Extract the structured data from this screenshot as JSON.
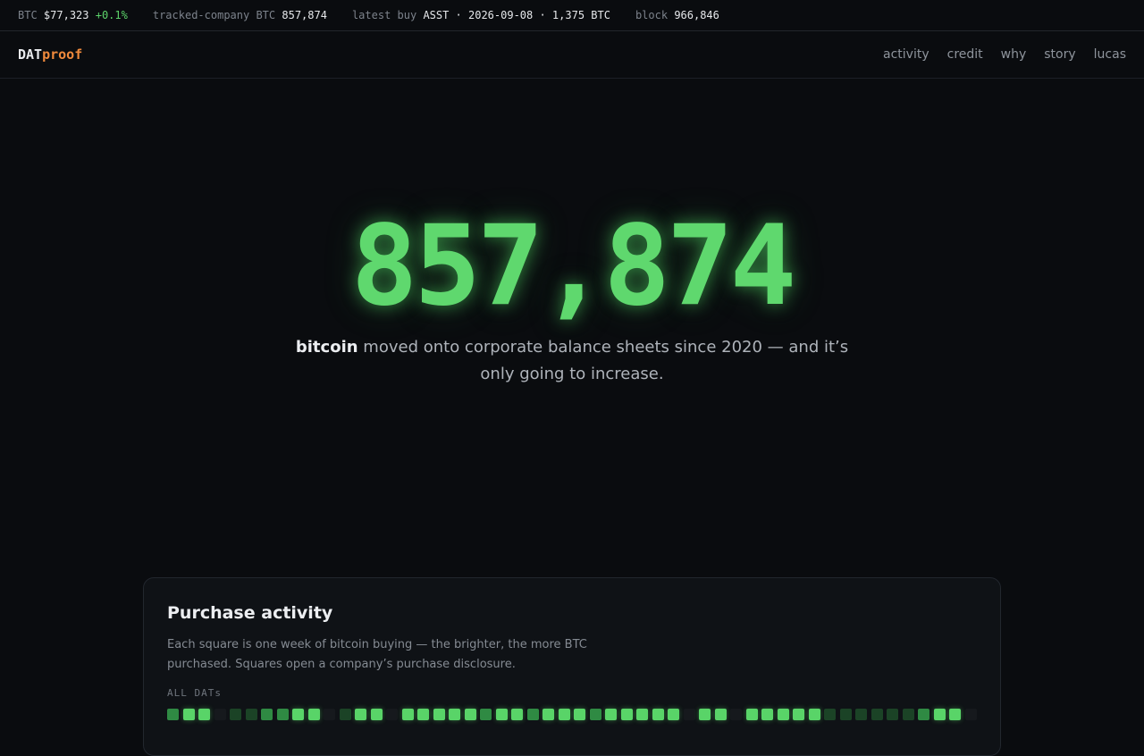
{
  "ticker": {
    "btc_label": "BTC",
    "btc_price": "$77,323",
    "btc_change": "+0.1%",
    "tracked_label": "tracked-company BTC",
    "tracked_value": "857,874",
    "latest_label": "latest buy",
    "latest_value": "ASST · 2026-09-08 · 1,375 BTC",
    "block_label": "block",
    "block_value": "966,846"
  },
  "brand": {
    "part1": "DAT",
    "part2": "proof",
    "accent_color": "#f08a3c"
  },
  "nav": {
    "items": [
      "activity",
      "credit",
      "why",
      "story",
      "lucas"
    ]
  },
  "hero": {
    "number": "857,874",
    "sub_bold": "bitcoin",
    "sub_rest": "moved onto corporate balance sheets since 2020 — and it’s only going to increase.",
    "accent_color": "#5fd86e"
  },
  "activity": {
    "title": "Purchase activity",
    "description": "Each square is one week of bitcoin buying — the brighter, the more BTC purchased. Squares open a company’s purchase disclosure.",
    "label": "ALL DATs",
    "weeks": [
      2,
      3,
      3,
      0,
      1,
      1,
      2,
      2,
      3,
      3,
      0,
      1,
      3,
      3,
      0,
      3,
      3,
      3,
      3,
      3,
      2,
      3,
      3,
      2,
      3,
      3,
      3,
      2,
      3,
      3,
      3,
      3,
      3,
      0,
      3,
      3,
      0,
      3,
      3,
      3,
      3,
      3,
      1,
      1,
      1,
      1,
      1,
      1,
      2,
      3,
      3,
      0
    ]
  }
}
